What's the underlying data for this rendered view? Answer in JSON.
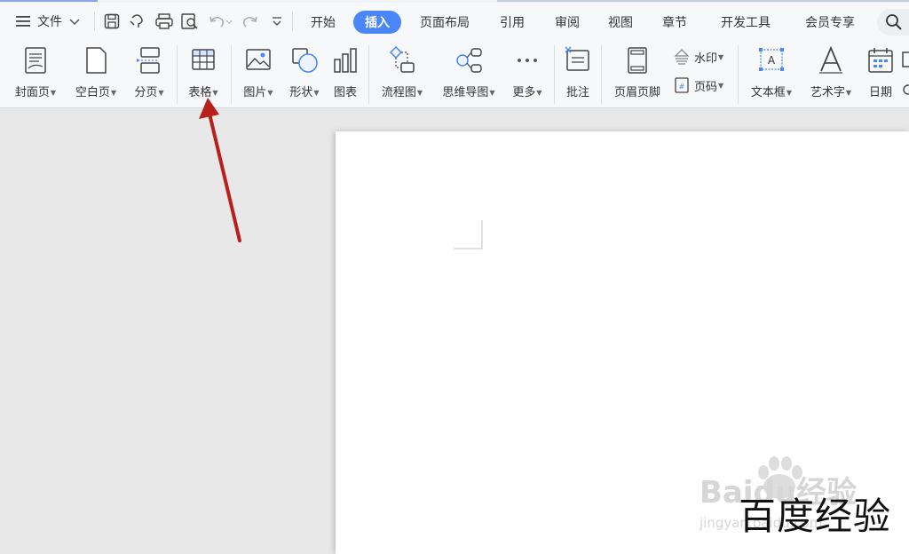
{
  "menubar": {
    "file_label": "文件",
    "tabs": [
      {
        "label": "开始"
      },
      {
        "label": "插入"
      },
      {
        "label": "页面布局"
      },
      {
        "label": "引用"
      },
      {
        "label": "审阅"
      },
      {
        "label": "视图"
      },
      {
        "label": "章节"
      },
      {
        "label": "开发工具"
      },
      {
        "label": "会员专享"
      }
    ],
    "active_tab": "插入"
  },
  "ribbon": {
    "buttons": [
      {
        "label": "封面页",
        "icon": "cover-page-icon"
      },
      {
        "label": "空白页",
        "icon": "blank-page-icon"
      },
      {
        "label": "分页",
        "icon": "page-break-icon"
      },
      {
        "label": "表格",
        "icon": "table-icon"
      },
      {
        "label": "图片",
        "icon": "picture-icon"
      },
      {
        "label": "形状",
        "icon": "shapes-icon"
      },
      {
        "label": "图表",
        "icon": "chart-icon"
      },
      {
        "label": "流程图",
        "icon": "flowchart-icon"
      },
      {
        "label": "思维导图",
        "icon": "mindmap-icon"
      },
      {
        "label": "更多",
        "icon": "more-icon"
      },
      {
        "label": "批注",
        "icon": "comment-icon"
      },
      {
        "label": "页眉页脚",
        "icon": "header-footer-icon"
      },
      {
        "label": "文本框",
        "icon": "textbox-icon"
      },
      {
        "label": "艺术字",
        "icon": "wordart-icon"
      },
      {
        "label": "日期",
        "icon": "date-icon"
      }
    ],
    "watermark_label": "水印",
    "pagenum_label": "页码"
  },
  "watermark_text": {
    "brand": "Baidu经验",
    "sub": "jingyan.baidu.com",
    "caption": "百度经验"
  },
  "colors": {
    "accent": "#4a86f7",
    "arrow": "#b8211b",
    "toolbar_bg": "#f7f8fa",
    "workspace_bg": "#e8e8e8"
  }
}
